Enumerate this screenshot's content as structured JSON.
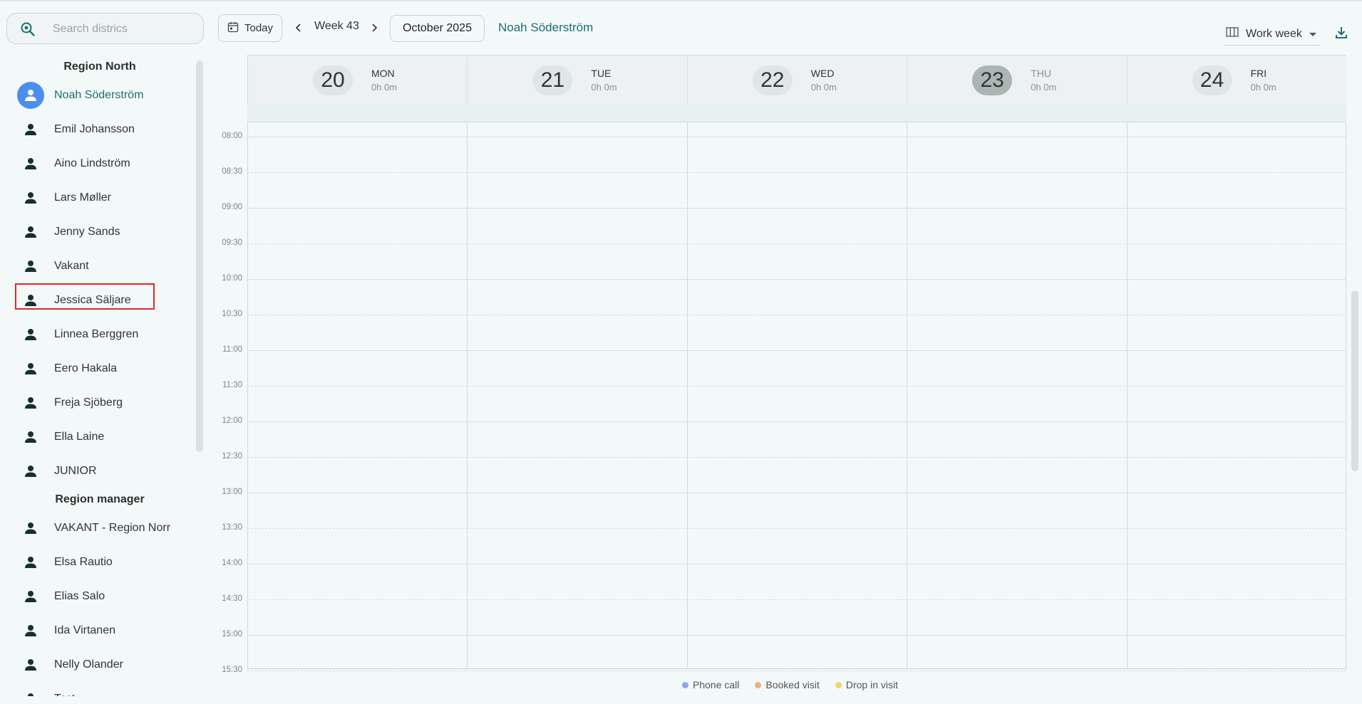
{
  "search": {
    "placeholder": "Search districs"
  },
  "sidebar": {
    "groups": [
      {
        "title": "Region North",
        "people": [
          "Noah Söderström",
          "Emil Johansson",
          "Aino Lindström",
          "Lars Møller",
          "Jenny Sands",
          "Vakant",
          "Jessica Säljare",
          "Linnea Berggren",
          "Eero Hakala",
          "Freja Sjöberg",
          "Ella Laine",
          "JUNIOR"
        ]
      },
      {
        "title": "Region manager",
        "people": [
          "VAKANT - Region Norr",
          "Elsa Rautio",
          "Elias Salo",
          "Ida Virtanen",
          "Nelly Olander",
          "Test"
        ]
      }
    ],
    "active_person": "Noah Söderström",
    "selected_person": "Jessica Säljare"
  },
  "toolbar": {
    "today_label": "Today",
    "week_label": "Week 43",
    "month_label": "October 2025",
    "person_title": "Noah Söderström",
    "view_label": "Work week"
  },
  "calendar": {
    "days": [
      {
        "num": "20",
        "name": "MON",
        "hours": "0h 0m",
        "today": false
      },
      {
        "num": "21",
        "name": "TUE",
        "hours": "0h 0m",
        "today": false
      },
      {
        "num": "22",
        "name": "WED",
        "hours": "0h 0m",
        "today": false
      },
      {
        "num": "23",
        "name": "THU",
        "hours": "0h 0m",
        "today": true
      },
      {
        "num": "24",
        "name": "FRI",
        "hours": "0h 0m",
        "today": false
      }
    ],
    "times": [
      "08:00",
      "08:30",
      "09:00",
      "09:30",
      "10:00",
      "10:30",
      "11:00",
      "11:30",
      "12:00",
      "12:30",
      "13:00",
      "13:30",
      "14:00",
      "14:30",
      "15:00",
      "15:30"
    ]
  },
  "legend": [
    {
      "label": "Phone call",
      "color": "#8fa6e6"
    },
    {
      "label": "Booked visit",
      "color": "#f0b080"
    },
    {
      "label": "Drop in visit",
      "color": "#f2d36a"
    }
  ],
  "colors": {
    "accent": "#1d6f6c",
    "active_avatar": "#4a8ff0",
    "selection_outline": "#e02828"
  }
}
